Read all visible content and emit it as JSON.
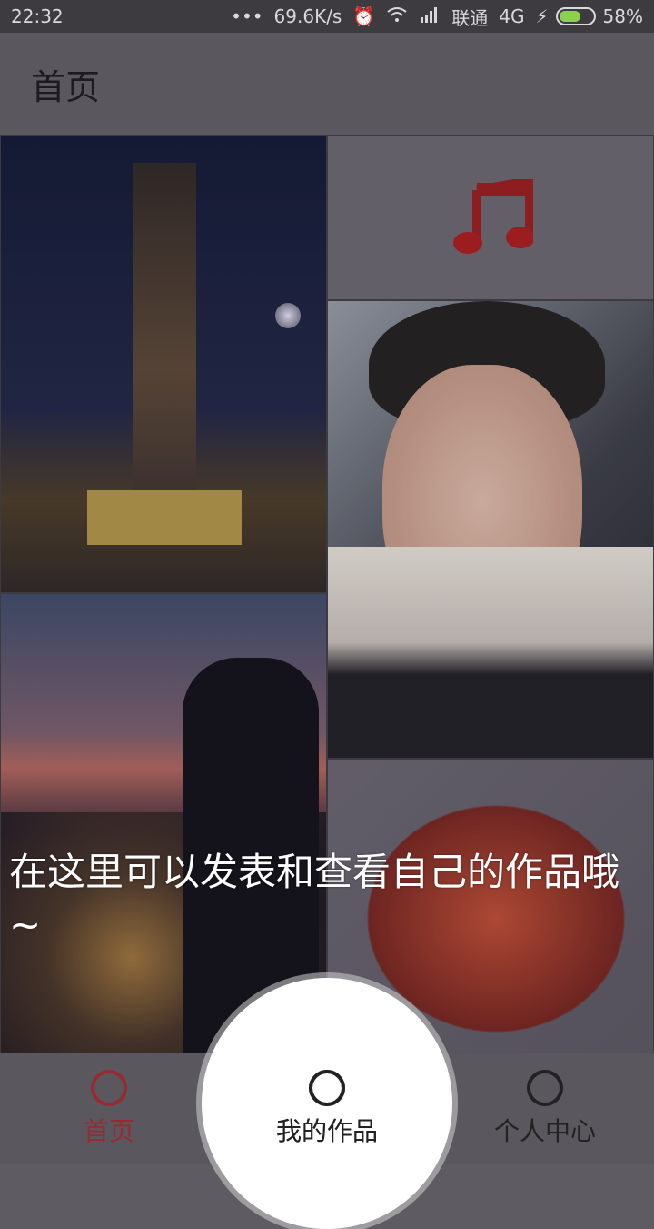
{
  "status_bar": {
    "time": "22:32",
    "dots": "•••",
    "speed": "69.6K/s",
    "carrier": "联通",
    "network": "4G",
    "battery": "58%",
    "battery_level": 0.58,
    "icons": [
      "alarm-icon",
      "wifi-icon",
      "signal-icon",
      "charging-icon",
      "battery-icon"
    ]
  },
  "app_bar": {
    "title": "首页"
  },
  "grid": {
    "tiles": [
      {
        "name": "photo-monument-night"
      },
      {
        "name": "music-note-tile",
        "icon": "music-note-icon",
        "icon_color": "#b01818"
      },
      {
        "name": "photo-portrait"
      },
      {
        "name": "photo-silhouette-city"
      },
      {
        "name": "photo-dragon-art"
      }
    ]
  },
  "overlay_tip": "在这里可以发表和查看自己的作品哦~",
  "bottom_nav": {
    "items": [
      {
        "label": "首页",
        "active": true,
        "color": "#9a2a32"
      },
      {
        "label": "我的作品",
        "active": false
      },
      {
        "label": "个人中心",
        "active": false
      }
    ]
  }
}
